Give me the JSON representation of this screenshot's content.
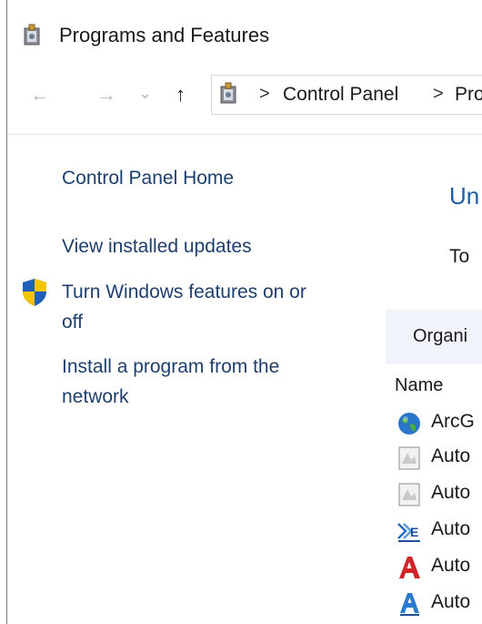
{
  "window": {
    "title": "Programs and Features",
    "icon": "programs-features-icon"
  },
  "nav": {
    "back_glyph": "←",
    "forward_glyph": "→",
    "recent_glyph": "⌄",
    "up_glyph": "↑",
    "breadcrumb": [
      "Control Panel",
      "Pro"
    ]
  },
  "sidebar": {
    "items": [
      {
        "label": "Control Panel Home"
      },
      {
        "label": "View installed updates"
      },
      {
        "label_line1": "Turn Windows features on or",
        "label_line2": "off",
        "icon": "uac-shield-icon"
      },
      {
        "label_line1": "Install a program from the",
        "label_line2": "network"
      }
    ]
  },
  "main": {
    "title": "Un",
    "subtitle": "To",
    "toolbar": {
      "organize_label": "Organi"
    },
    "list": {
      "column_name": "Name",
      "rows": [
        {
          "label": "ArcG",
          "icon": "arcgis-globe-icon"
        },
        {
          "label": "Auto",
          "icon": "generic-installer-icon"
        },
        {
          "label": "Auto",
          "icon": "generic-installer-icon"
        },
        {
          "label": "Auto",
          "icon": "autodesk-graph-icon"
        },
        {
          "label": "Auto",
          "icon": "autocad-red-a-icon"
        },
        {
          "label": "Auto",
          "icon": "autocad-blue-a-icon"
        }
      ]
    }
  },
  "colors": {
    "link": "#1e3f6e",
    "title_accent": "#1e5ea8",
    "toolbar_bg": "#f1f5fb"
  }
}
